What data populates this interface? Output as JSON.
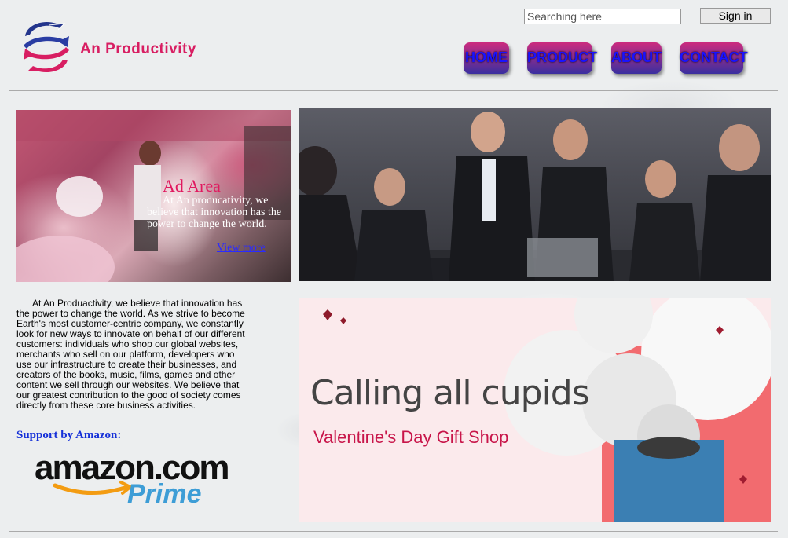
{
  "header": {
    "brand_name": "An Productivity",
    "search_placeholder": "Searching here",
    "signin_label": "Sign in"
  },
  "nav": {
    "items": [
      "HOME",
      "PRODUCT",
      "ABOUT",
      "CONTACT"
    ]
  },
  "ad": {
    "title": "Ad Area",
    "text": "At An producativity, we believe that innovation has the power to change the world.",
    "link": "View more"
  },
  "about": {
    "text": "At An Produactivity, we believe that innovation has the power to change the world. As we strive to become Earth's most customer-centric company, we constantly look for new ways to innovate on behalf of our different customers: individuals who shop our global websites, merchants who sell on our platform, developers who use our infrastructure to create their businesses, and creators of the books, music, films, games and other content we sell through our websites. We believe that our greatest contribution to the good of society comes directly from these core business activities.",
    "support_label": "Support by Amazon:"
  },
  "amazon_logo": {
    "wordmark": "amazon.com",
    "prime": "Prime"
  },
  "banner": {
    "title": "Calling all cupids",
    "subtitle": "Valentine's Day Gift Shop"
  },
  "colors": {
    "brand": "#d81e62",
    "nav_text": "#1a12ff",
    "support": "#1530d8"
  }
}
